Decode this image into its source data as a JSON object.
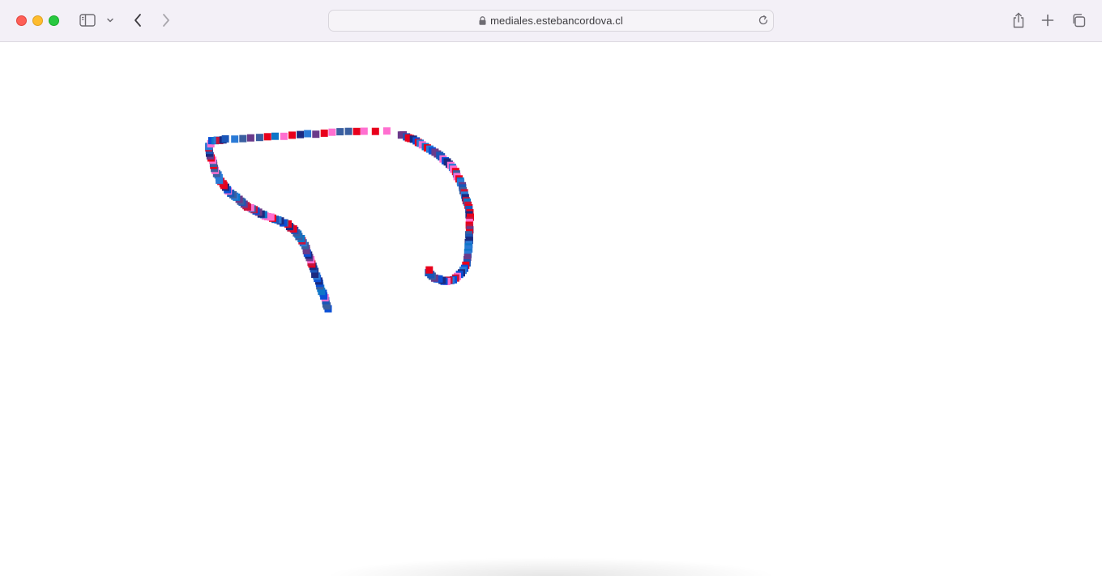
{
  "browser": {
    "url": "mediales.estebancordova.cl",
    "icons": {
      "close": "close-traffic-light",
      "minimize": "minimize-traffic-light",
      "maximize": "maximize-traffic-light",
      "sidebar": "sidebar-icon",
      "sidebar_menu": "chevron-down-icon",
      "back": "chevron-left-icon",
      "forward": "chevron-right-icon",
      "lock": "lock-icon",
      "reload": "reload-icon",
      "share": "share-icon",
      "new_tab": "plus-icon",
      "tabs": "tabs-overview-icon"
    }
  },
  "drawing": {
    "palette": [
      "#e8001c",
      "#0a4fd6",
      "#1b2a80",
      "#2a7ad6",
      "#ff6fd0",
      "#3a5fa0",
      "#c8143c",
      "#1a56b8",
      "#6a3a8a",
      "#0e76c8"
    ],
    "mark": "square"
  }
}
